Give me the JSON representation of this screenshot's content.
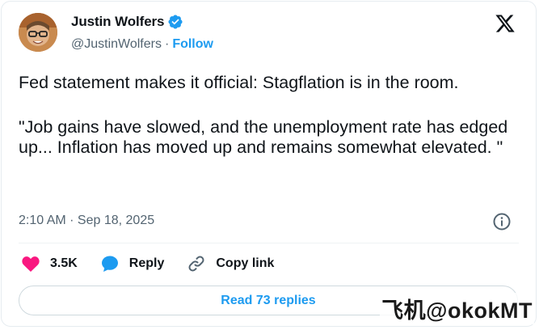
{
  "author": {
    "name": "Justin Wolfers",
    "handle": "@JustinWolfers",
    "separator": "·",
    "follow_label": "Follow"
  },
  "tweet": {
    "paragraphs": [
      "Fed statement makes it official: Stagflation is in the room.",
      "\"Job gains have slowed, and the unemployment rate has edged up... Inflation has moved up and remains somewhat elevated. \""
    ],
    "timestamp": "2:10 AM · Sep 18, 2025"
  },
  "actions": {
    "like_count": "3.5K",
    "reply_label": "Reply",
    "copy_label": "Copy link"
  },
  "replies_button": "Read 73 replies",
  "watermark": "飞机@okokMT",
  "colors": {
    "accent": "#1d9bf0",
    "like": "#f91880",
    "secondary_text": "#536471"
  },
  "icons": [
    "verified-badge-icon",
    "x-logo-icon",
    "info-icon",
    "heart-icon",
    "reply-bubble-icon",
    "link-icon"
  ]
}
